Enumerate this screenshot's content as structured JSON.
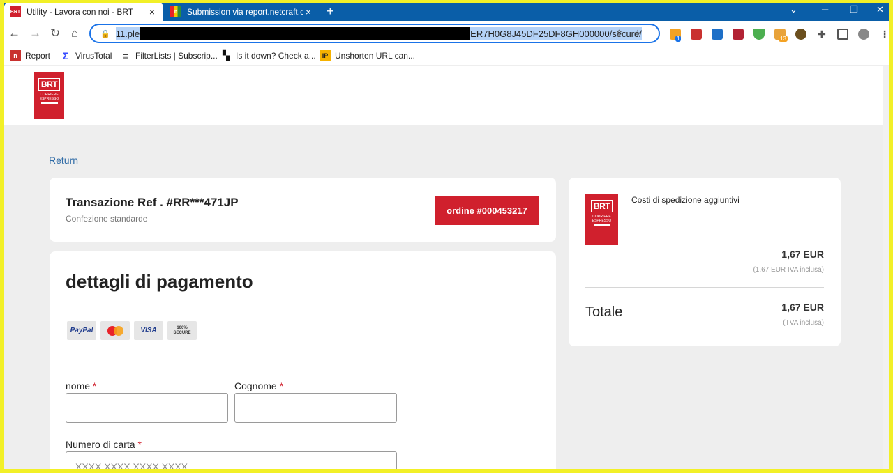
{
  "browser": {
    "tabs": [
      {
        "title": "Utility - Lavora con noi - BRT",
        "favicon": "BRT"
      },
      {
        "title": "Submission via report.netcraft.co",
        "favicon": "n"
      }
    ],
    "new_tab": "+",
    "window_controls": {
      "minimize": "⌄",
      "minimize2": "─",
      "restore": "❐",
      "close": "✕"
    },
    "nav": {
      "back": "←",
      "forward": "→",
      "reload": "↻",
      "home": "⌂"
    },
    "url_start": "11.ple",
    "url_end": "ER7H0G8J45DF25DF8GH000000/secure/",
    "extensions": [
      {
        "name": "folder-ext-icon",
        "color": "#f4a223",
        "badge": "1"
      },
      {
        "name": "netcraft-ext-icon",
        "color": "#c9312f",
        "badge": ""
      },
      {
        "name": "shield-ext-icon",
        "color": "#1d6fc7",
        "badge": ""
      },
      {
        "name": "flag-ext-icon",
        "color": "#b22234",
        "badge": ""
      },
      {
        "name": "adguard-ext-icon",
        "color": "#4caf50",
        "badge": ""
      },
      {
        "name": "cookie-ext-icon",
        "color": "#e8a33a",
        "badge": "13"
      },
      {
        "name": "globe-ext-icon",
        "color": "#6b4f1d",
        "badge": ""
      }
    ],
    "bookmarks": [
      {
        "label": "Report",
        "icon": "n"
      },
      {
        "label": "VirusTotal",
        "icon": "Σ"
      },
      {
        "label": "FilterLists | Subscrip...",
        "icon": "≡"
      },
      {
        "label": "Is it down? Check a...",
        "icon": "▚"
      },
      {
        "label": "Unshorten URL can...",
        "icon": "IP"
      }
    ]
  },
  "page": {
    "logo": {
      "word": "BRT",
      "sub1": "CORRIERE",
      "sub2": "ESPRESSO"
    },
    "return_label": "Return",
    "transaction": {
      "title": "Transazione Ref . #RR***471JP",
      "subtitle": "Confezione standarde",
      "order": "ordine #000453217"
    },
    "payment": {
      "title": "dettagli di pagamento",
      "cards": [
        "PayPal",
        "MasterCard",
        "VISA",
        "100% SECURE"
      ],
      "first_name_label": "nome",
      "last_name_label": "Cognome",
      "card_number_label": "Numero di carta",
      "card_number_placeholder": "XXXX XXXX XXXX XXXX",
      "required_mark": "*"
    },
    "summary": {
      "description": "Costi di spedizione aggiuntivi",
      "price": "1,67 EUR",
      "price_vat": "(1,67 EUR IVA inclusa)",
      "total_label": "Totale",
      "total": "1,67 EUR",
      "total_vat": "(TVA inclusa)"
    }
  },
  "colors": {
    "brand_red": "#d0202d",
    "tab_bar": "#0a5ea8",
    "link": "#2f6ba6"
  }
}
